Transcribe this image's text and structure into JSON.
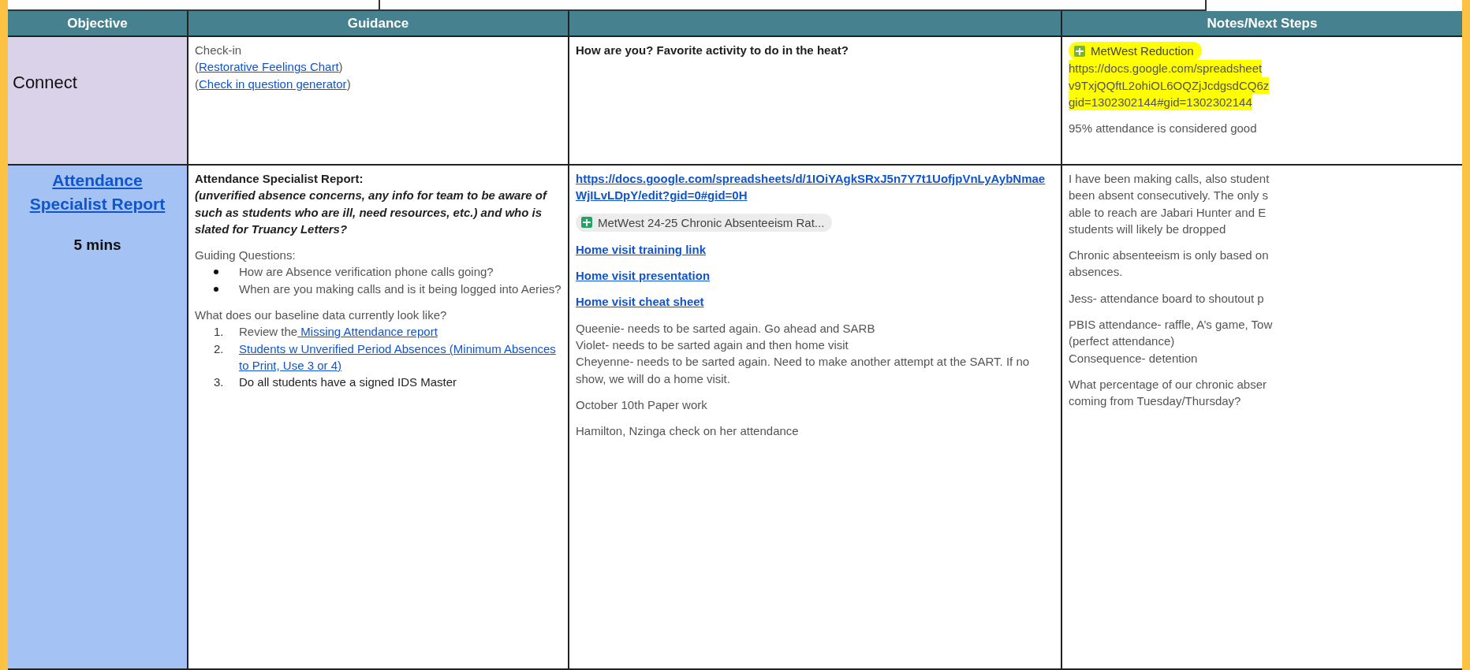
{
  "header": {
    "objective": "Objective",
    "guidance": "Guidance",
    "notes": "Notes/Next Steps"
  },
  "rows": [
    {
      "color": "#d9d2e9",
      "objective": [
        {
          "kind": "heading",
          "text": "Connect"
        }
      ],
      "guidance": [
        {
          "kind": "paras",
          "paragraphs": [
            {
              "kind": "plain",
              "parts": [
                {
                  "kind": "text",
                  "text": "Check-in"
                }
              ]
            },
            {
              "kind": "plain",
              "parts": [
                {
                  "kind": "text",
                  "text": "("
                },
                {
                  "kind": "link",
                  "text": "Restorative Feelings Chart"
                },
                {
                  "kind": "text",
                  "text": ")"
                }
              ]
            },
            {
              "kind": "plain",
              "parts": [
                {
                  "kind": "text",
                  "text": "("
                },
                {
                  "kind": "link",
                  "text": "Check in question generator"
                },
                {
                  "kind": "text",
                  "text": ")"
                }
              ]
            }
          ]
        }
      ],
      "column_3": [
        {
          "kind": "paras",
          "paragraphs": [
            {
              "kind": "strong",
              "parts": [
                {
                  "kind": "text",
                  "text": "How are you? Favorite activity to do in the heat?"
                }
              ]
            }
          ]
        }
      ],
      "notes": [
        {
          "kind": "chip",
          "text": "MetWest Reduction",
          "highlight": true,
          "lines": [
            "https://docs.google.com/spreadsheet",
            "v9TxjQQftL2ohiOL6OQZjJcdgsdCQ6z",
            "gid=1302302144#gid=1302302144"
          ]
        },
        {
          "kind": "lines",
          "highlight": false,
          "lines": [
            "95% attendance is considered good"
          ]
        }
      ]
    },
    {
      "color": "#a4c2f4",
      "objective": [
        {
          "kind": "heading_link",
          "text": "Attendance Specialist Report"
        },
        {
          "kind": "heading",
          "text": "5 mins"
        }
      ],
      "guidance": [
        {
          "kind": "paras",
          "paragraphs": [
            {
              "kind": "strong",
              "parts": [
                {
                  "kind": "text",
                  "text": "Attendance Specialist Report:"
                }
              ]
            },
            {
              "kind": "emphasis",
              "parts": [
                {
                  "kind": "text",
                  "text": "(unverified absence concerns, any info for team to be aware of such as students who are ill, need resources, etc.) and who is slated for Truancy Letters?"
                }
              ]
            }
          ]
        },
        {
          "kind": "paras",
          "paragraphs": [
            {
              "kind": "plain",
              "parts": [
                {
                  "kind": "text",
                  "text": "Guiding Questions:"
                }
              ]
            }
          ],
          "bullets": [
            "How are Absence verification phone calls going?",
            "When are you making calls and is it being logged into Aeries?"
          ]
        },
        {
          "kind": "paras",
          "paragraphs": [
            {
              "kind": "plain",
              "parts": [
                {
                  "kind": "text",
                  "text": "What does our baseline data currently look like?"
                }
              ]
            }
          ],
          "numbered": [
            {
              "number": "1.",
              "kind": "plain",
              "parts": [
                {
                  "kind": "text",
                  "text": "Review the"
                },
                {
                  "kind": "link",
                  "text": " Missing Attendance report"
                }
              ]
            },
            {
              "number": "2.",
              "kind": "link",
              "text": "Students w Unverified Period Absences (Minimum Absences to Print, Use 3 or 4)"
            },
            {
              "number": "3.",
              "kind": "dark",
              "parts": [
                {
                  "kind": "text",
                  "text": "Do all students have a signed IDS Master"
                }
              ]
            }
          ]
        }
      ],
      "column_3": [
        {
          "kind": "strong_link",
          "text": "https://docs.google.com/spreadsheets/d/1IOiYAgkSRxJ5n7Y7t1UofjpVnLyAybNmaeWjILvLDpY/edit?gid=0#gid=0H"
        },
        {
          "kind": "chip",
          "text": "MetWest 24-25 Chronic Absenteeism Rat...",
          "highlight": false
        },
        {
          "kind": "strong_link",
          "text": "Home visit training link"
        },
        {
          "kind": "strong_link",
          "text": "Home visit presentation"
        },
        {
          "kind": "strong_link",
          "text": "Home visit cheat sheet"
        },
        {
          "kind": "paras",
          "paragraphs": [
            {
              "kind": "plain",
              "parts": [
                {
                  "kind": "text",
                  "text": "Queenie- needs to be sarted again. Go ahead and SARB"
                }
              ]
            },
            {
              "kind": "plain",
              "parts": [
                {
                  "kind": "text",
                  "text": "Violet- needs to be sarted again and then home visit"
                }
              ]
            },
            {
              "kind": "plain",
              "parts": [
                {
                  "kind": "text",
                  "text": "Cheyenne- needs to be sarted again. Need to make another attempt at the SART. If no show, we will do a home visit."
                }
              ]
            }
          ]
        },
        {
          "kind": "paras",
          "paragraphs": [
            {
              "kind": "plain",
              "parts": [
                {
                  "kind": "text",
                  "text": "October 10th Paper work"
                }
              ]
            }
          ]
        },
        {
          "kind": "paras",
          "paragraphs": [
            {
              "kind": "plain",
              "parts": [
                {
                  "kind": "text",
                  "text": "Hamilton, Nzinga check on her attendance"
                }
              ]
            }
          ]
        }
      ],
      "notes": [
        {
          "kind": "lines",
          "highlight": false,
          "lines": [
            "I have been making calls, also student",
            "been absent consecutively. The only s",
            "able to reach are Jabari Hunter and E",
            "students will likely be dropped"
          ]
        },
        {
          "kind": "lines",
          "highlight": false,
          "lines": [
            "Chronic absenteeism is only based on",
            "absences."
          ]
        },
        {
          "kind": "lines",
          "highlight": false,
          "lines": [
            "Jess- attendance board to shoutout p"
          ]
        },
        {
          "kind": "lines",
          "highlight": false,
          "lines": [
            "PBIS attendance- raffle, A’s game, Tow",
            "(perfect attendance)",
            "Consequence- detention"
          ]
        },
        {
          "kind": "lines",
          "highlight": false,
          "lines": [
            "What percentage of our chronic abser",
            "coming from Tuesday/Thursday?"
          ]
        }
      ]
    }
  ]
}
